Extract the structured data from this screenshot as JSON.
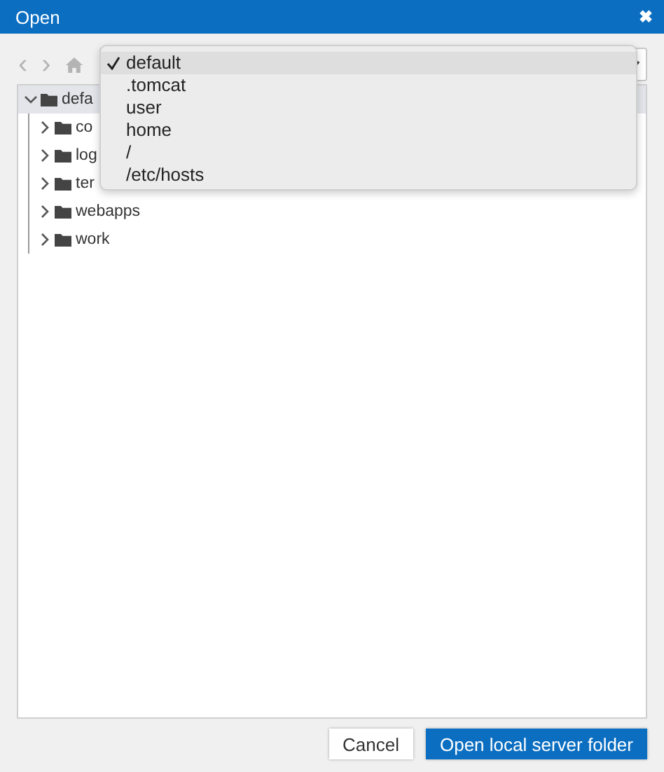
{
  "window": {
    "title": "Open",
    "close": "✖"
  },
  "toolbar": {
    "back": "‹",
    "forward": "›"
  },
  "tree": {
    "label": "defa",
    "expanded": true,
    "selected": true,
    "children": [
      {
        "label": "co",
        "expanded": false,
        "selected": false
      },
      {
        "label": "log",
        "expanded": false,
        "selected": false
      },
      {
        "label": "ter",
        "expanded": false,
        "selected": false
      },
      {
        "label": "webapps",
        "expanded": false,
        "selected": false
      },
      {
        "label": "work",
        "expanded": false,
        "selected": false
      }
    ]
  },
  "menu": [
    {
      "label": "default",
      "selected": true
    },
    {
      "label": ".tomcat",
      "selected": false
    },
    {
      "label": "user",
      "selected": false
    },
    {
      "label": "home",
      "selected": false
    },
    {
      "label": "/",
      "selected": false
    },
    {
      "label": "/etc/hosts",
      "selected": false
    }
  ],
  "buttons": [
    {
      "label": "Cancel",
      "kind": "secondary"
    },
    {
      "label": "Open local server folder",
      "kind": "primary"
    }
  ]
}
